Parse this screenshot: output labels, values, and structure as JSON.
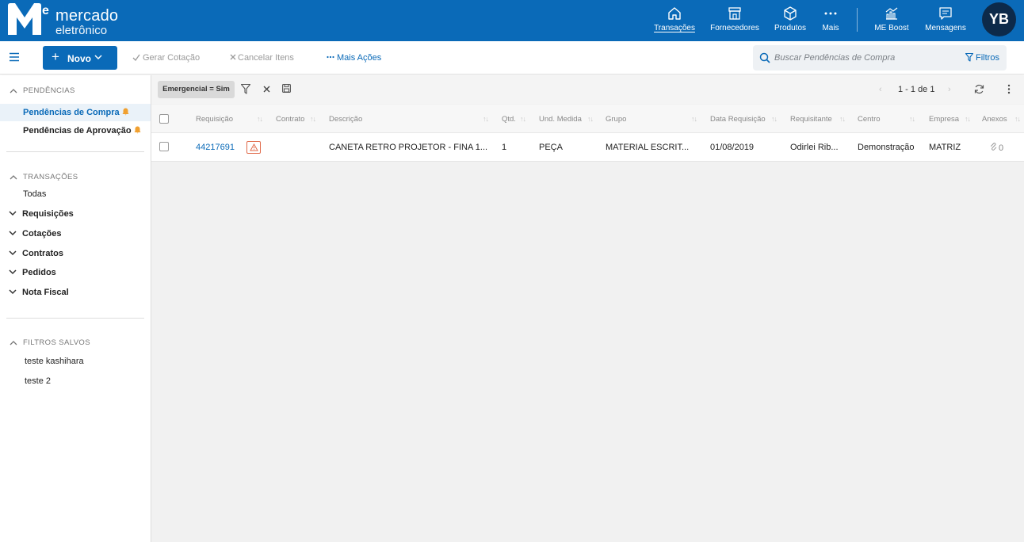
{
  "brand": {
    "line1": "mercado",
    "line2": "eletrônico"
  },
  "nav": [
    {
      "label": "Transações",
      "icon": "home-icon",
      "active": true
    },
    {
      "label": "Fornecedores",
      "icon": "store-icon"
    },
    {
      "label": "Produtos",
      "icon": "box-icon"
    },
    {
      "label": "Mais",
      "icon": "more-dots-icon"
    },
    {
      "label": "ME Boost",
      "icon": "chart-icon"
    },
    {
      "label": "Mensagens",
      "icon": "message-icon"
    }
  ],
  "user": {
    "initials": "YB"
  },
  "toolbar": {
    "novo_label": "Novo",
    "gerar_cotacao": "Gerar Cotação",
    "cancelar_itens": "Cancelar Itens",
    "mais_acoes": "Mais Ações",
    "search_placeholder": "Buscar Pendências de Compra",
    "filtros_label": "Filtros"
  },
  "sidebar": {
    "pendencias_title": "PENDÊNCIAS",
    "pendencias": [
      {
        "label": "Pendências de Compra",
        "active": true
      },
      {
        "label": "Pendências de Aprovação"
      }
    ],
    "transacoes_title": "TRANSAÇÕES",
    "todas": "Todas",
    "groups": [
      "Requisições",
      "Cotações",
      "Contratos",
      "Pedidos",
      "Nota Fiscal"
    ],
    "filtros_title": "FILTROS SALVOS",
    "filtros": [
      "teste kashihara",
      "teste 2"
    ]
  },
  "filterbar": {
    "chip": "Emergencial = Sim",
    "pager": "1 - 1 de 1"
  },
  "table": {
    "columns": [
      "Requisição",
      "Contrato",
      "Descrição",
      "Qtd.",
      "Und. Medida",
      "Grupo",
      "Data Requisição",
      "Requisitante",
      "Centro",
      "Empresa",
      "Anexos"
    ],
    "rows": [
      {
        "requisicao": "44217691",
        "contrato": "",
        "descricao": "CANETA RETRO PROJETOR - FINA 1...",
        "qtd": "1",
        "und": "PEÇA",
        "grupo": "MATERIAL ESCRIT...",
        "data": "01/08/2019",
        "requisitante": "Odirlei Rib...",
        "centro": "Demonstração",
        "empresa": "MATRIZ",
        "anexos": "0"
      }
    ]
  },
  "colors": {
    "primary": "#0a6ab8",
    "avatar_bg": "#0d2a4a",
    "warning": "#e06a4a",
    "bell": "#f0a030"
  }
}
